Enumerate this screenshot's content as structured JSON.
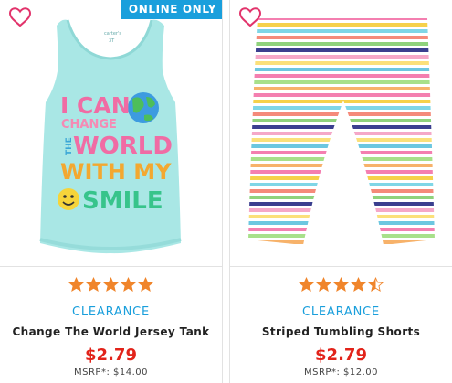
{
  "colors": {
    "accent": "#1a9fdc",
    "price": "#e2231a",
    "star": "#f0852b",
    "heart": "#e2336b"
  },
  "products": [
    {
      "badge": "ONLINE ONLY",
      "image_icon": "tank-top-image",
      "image_text": [
        "I CAN",
        "CHANGE",
        "THE",
        "WORLD",
        "WITH MY",
        "SMILE"
      ],
      "rating": 5,
      "status": "CLEARANCE",
      "name": "Change The World Jersey Tank",
      "price": "$2.79",
      "msrp": "MSRP*: $14.00"
    },
    {
      "badge": "",
      "image_icon": "striped-shorts-image",
      "rating": 4.5,
      "status": "CLEARANCE",
      "name": "Striped Tumbling Shorts",
      "price": "$2.79",
      "msrp": "MSRP*: $12.00"
    }
  ]
}
